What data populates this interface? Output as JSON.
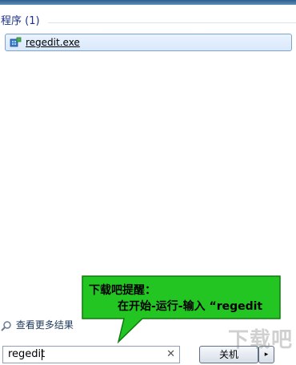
{
  "section": {
    "title": "程序 (1)"
  },
  "results": [
    {
      "label": "regedit.exe",
      "icon": "registry-editor-icon"
    }
  ],
  "see_more": {
    "label": "查看更多结果",
    "icon": "search-icon"
  },
  "search": {
    "value": "regedit",
    "clear_icon": "close-icon"
  },
  "shutdown": {
    "label": "关机",
    "arrow": "▸"
  },
  "callout": {
    "title": "下载吧提醒：",
    "body": "在开始-运行-输入 “regedit"
  },
  "watermark": {
    "text": "下载吧"
  },
  "colors": {
    "callout_fill": "#22c522",
    "callout_border": "#0f7a0f",
    "highlight_border": "#7da2ce"
  }
}
